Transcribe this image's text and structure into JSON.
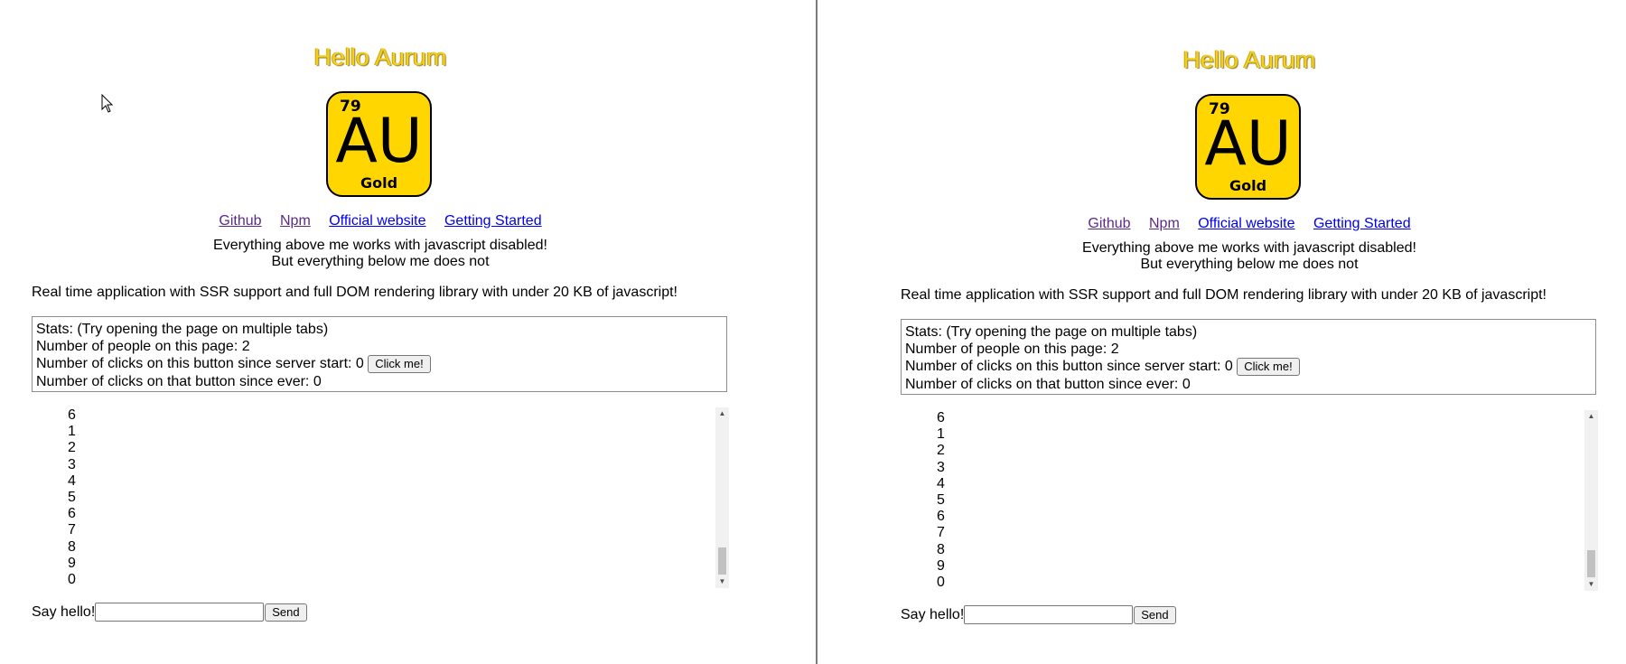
{
  "title": "Hello Aurum",
  "logo": {
    "atomic_number": "79",
    "symbol": "AU",
    "element_name": "Gold"
  },
  "links": [
    {
      "label": "Github",
      "visited": true
    },
    {
      "label": "Npm",
      "visited": true
    },
    {
      "label": "Official website",
      "visited": false
    },
    {
      "label": "Getting Started",
      "visited": false
    }
  ],
  "notes": {
    "line1": "Everything above me works with javascript disabled!",
    "line2": "But everything below me does not"
  },
  "description": "Real time application with SSR support and full DOM rendering library with under 20 KB of javascript!",
  "stats": {
    "header": "Stats: (Try opening the page on multiple tabs)",
    "people": "Number of people on this page: 2",
    "clicks_server": "Number of clicks on this button since server start: 0",
    "button_label": "Click me!",
    "clicks_ever": "Number of clicks on that button since ever: 0"
  },
  "list_items": [
    "6",
    "1",
    "2",
    "3",
    "4",
    "5",
    "6",
    "7",
    "8",
    "9",
    "0"
  ],
  "hello_form": {
    "label": "Say hello!",
    "input_value": "",
    "send_label": "Send"
  },
  "colors": {
    "title": "#f5cf1c",
    "logo_bg": "#ffd600",
    "visited_link": "#5b2a86",
    "unvisited_link": "#0000ee"
  }
}
